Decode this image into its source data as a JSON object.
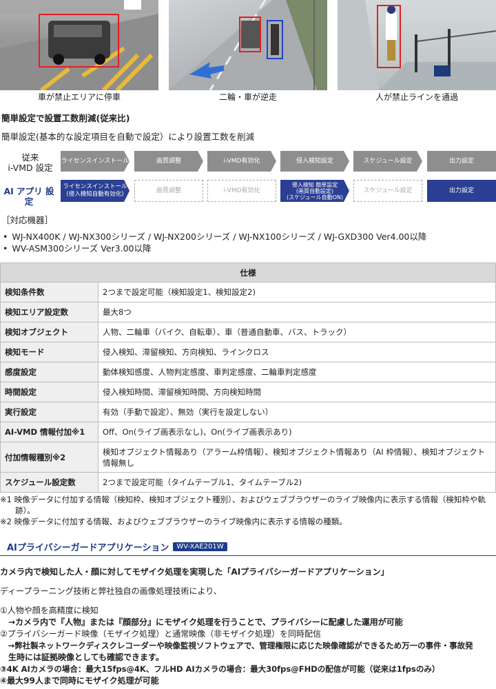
{
  "images": [
    {
      "caption": "車が禁止エリアに停車"
    },
    {
      "caption": "二輪・車が逆走"
    },
    {
      "caption": "人が禁止ラインを通過"
    }
  ],
  "simple_setting": {
    "heading": "簡単設定で設置工数削減(従来比)",
    "desc": "簡単設定(基本的な設定項目を自動で設定）により設置工数を削減"
  },
  "flow": {
    "row1_label": "従来\ni-VMD 設定",
    "row2_label": "AI アプリ 設定",
    "row1_steps": [
      "ライセンスインストール",
      "画質調整",
      "i-VMD有効化",
      "侵入検知設定",
      "スケジュール設定",
      "出力設定"
    ],
    "row2_steps": [
      "ライセンスインストール\n(侵入検知自動有効化)",
      "画質調整",
      "i-VMD有効化",
      "侵入検知 簡単設定\n(画質自動設定)\n(スケジュール自動ON)",
      "スケジュール設定",
      "出力設定"
    ]
  },
  "devices": {
    "heading": "［対応機器］",
    "items": [
      "WJ-NX400K / WJ-NX300シリーズ / WJ-NX200シリーズ / WJ-NX100シリーズ / WJ-GXD300 Ver4.00以降",
      "WV-ASM300シリーズ Ver3.00以降"
    ]
  },
  "spec": {
    "header": "仕様",
    "rows": [
      {
        "k": "検知条件数",
        "v": "2つまで設定可能（検知設定1、検知設定2)"
      },
      {
        "k": "検知エリア設定数",
        "v": "最大8つ"
      },
      {
        "k": "検知オブジェクト",
        "v": "人物、二輪車（バイク、自転車）、車（普通自動車、バス、トラック）"
      },
      {
        "k": "検知モード",
        "v": "侵入検知、滞留検知、方向検知、ラインクロス"
      },
      {
        "k": "感度設定",
        "v": "動体検知感度、人物判定感度、車判定感度、二輪車判定感度"
      },
      {
        "k": "時間設定",
        "v": "侵入検知時間、滞留検知時間、方向検知時間"
      },
      {
        "k": "実行設定",
        "v": "有効（手動で設定）、無効（実行を設定しない）"
      },
      {
        "k": "AI-VMD 情報付加※1",
        "v": "Off、On(ライブ画表示なし)、On(ライブ画表示あり)"
      },
      {
        "k": "付加情報種別※2",
        "v": "検知オブジェクト情報あり（アラーム枠情報）、検知オブジェクト情報あり（AI 枠情報）、検知オブジェクト情報無し"
      },
      {
        "k": "スケジュール設定数",
        "v": "2つまで設定可能（タイムテーブル1、タイムテーブル2)"
      }
    ]
  },
  "notes": [
    "※1 映像データに付加する情報（検知枠、検知オブジェクト種別）、およびウェブブラウザーのライブ映像内に表示する情報（検知枠や軌跡）。",
    "※2 映像データに付加する情報、およびウェブブラウザーのライブ映像内に表示する情報の種類。"
  ],
  "privacy": {
    "title": "AIプライバシーガードアプリケーション",
    "badge": "WV-XAE201W",
    "lead": "カメラ内で検知した人・顔に対してモザイク処理を実現した「AIプライバシーガードアプリケーション」",
    "intro": "ディープラーニング技術と弊社独自の画像処理技術により、",
    "lines": [
      {
        "text": "①人物や顔を高精度に検知",
        "bold": false
      },
      {
        "text": "　→カメラ内で『人物』または『顔部分』にモザイク処理を行うことで、プライバシーに配慮した運用が可能",
        "bold": true
      },
      {
        "text": "②プライバシーガード映像（モザイク処理）と通常映像（非モザイク処理）を同時配信",
        "bold": false
      },
      {
        "text": "　→弊社製ネットワークディスクレコーダーや映像監視ソフトウェアで、管理権限に応じた映像確認ができるため万一の事件・事故発",
        "bold": true
      },
      {
        "text": "　生時には証拠映像としても確認できます。",
        "bold": true
      },
      {
        "text": "③4K AIカメラの場合：最大15fps@4K、フルHD AIカメラの場合：最大30fps@FHDの配信が可能（従来は1fpsのみ）",
        "bold": true
      },
      {
        "text": "④最大99人まで同時にモザイク処理が可能",
        "bold": true
      }
    ]
  }
}
